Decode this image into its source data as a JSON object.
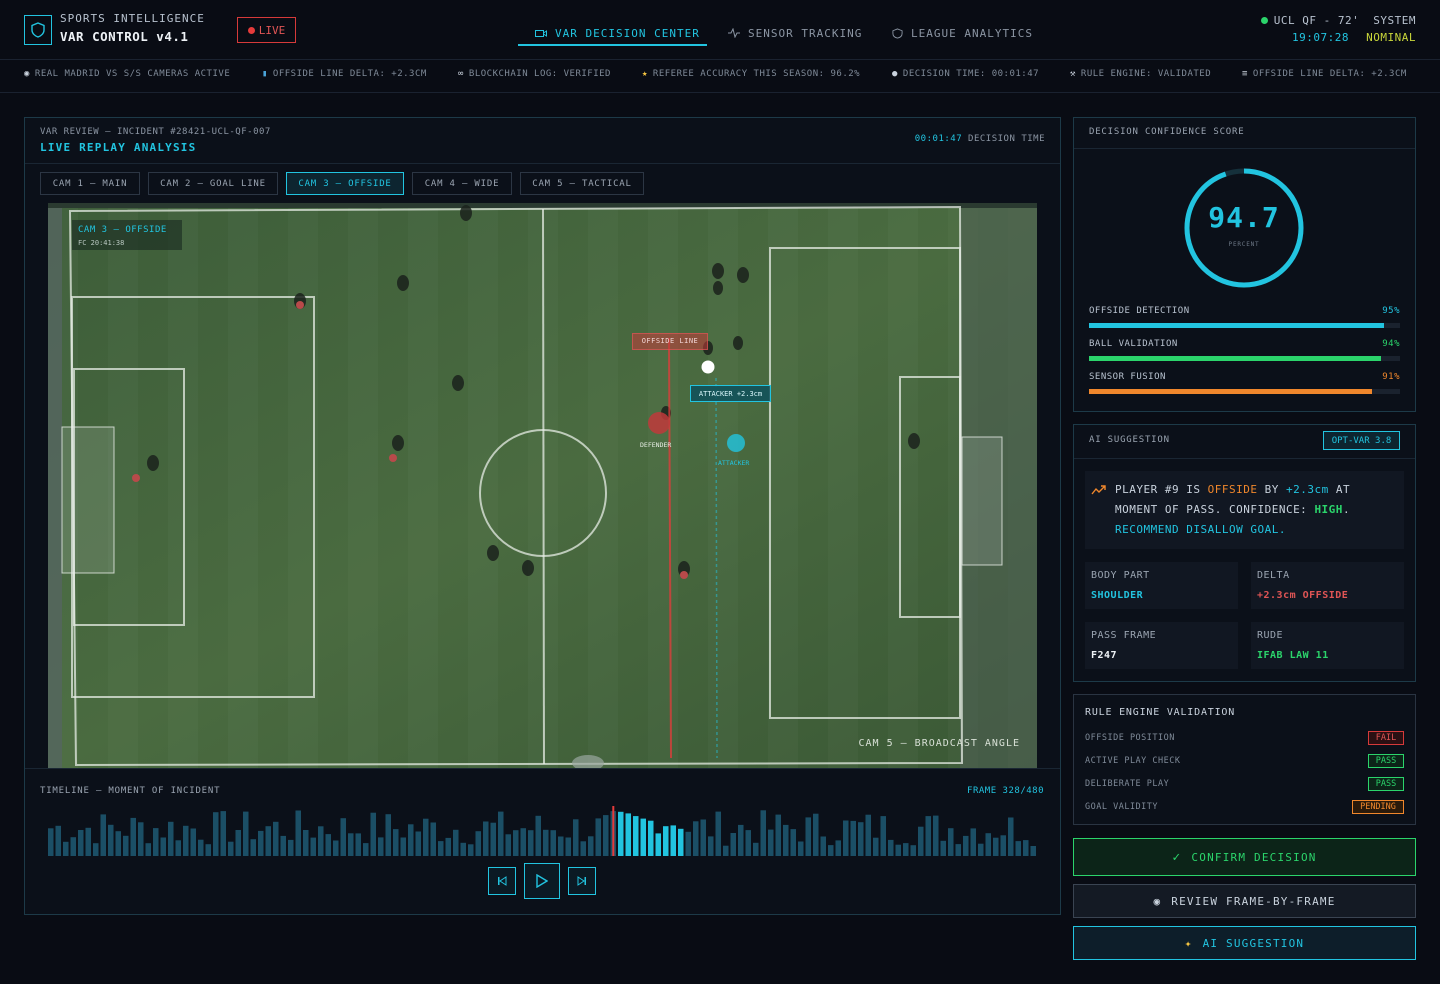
{
  "header": {
    "brand_line1": "SPORTS INTELLIGENCE",
    "brand_line2": "VAR CONTROL v4.1",
    "live_label": "LIVE",
    "nav": [
      {
        "label": "VAR DECISION CENTER",
        "icon": "camera-icon",
        "active": true
      },
      {
        "label": "SENSOR TRACKING",
        "icon": "pulse-icon",
        "active": false
      },
      {
        "label": "LEAGUE ANALYTICS",
        "icon": "shield-icon",
        "active": false
      }
    ],
    "match": "UCL QF - 72'",
    "system_label": "SYSTEM",
    "clock": "19:07:28",
    "system_status": "NOMINAL",
    "colors": {
      "accent": "#22c4e0",
      "ok": "#2bd46b",
      "alert": "#e53b3b",
      "warn": "#f0872c"
    }
  },
  "ticker": [
    {
      "icon": "camera-icon",
      "text": "REAL MADRID VS S/S CAMERAS ACTIVE"
    },
    {
      "icon": "chart-icon",
      "text": "OFFSIDE LINE DELTA: +2.3CM"
    },
    {
      "icon": "link-icon",
      "text": "BLOCKCHAIN LOG: VERIFIED"
    },
    {
      "icon": "star-icon",
      "text": "REFEREE ACCURACY THIS SEASON: 96.2%"
    },
    {
      "icon": "clock-icon",
      "text": "DECISION TIME: 00:01:47"
    },
    {
      "icon": "wrench-icon",
      "text": "RULE ENGINE: VALIDATED"
    },
    {
      "icon": "sensor-icon",
      "text": "OFFSIDE LINE DELTA: +2.3CM"
    }
  ],
  "review": {
    "incident": "VAR REVIEW — INCIDENT #28421-UCL-QF-007",
    "title": "LIVE REPLAY ANALYSIS",
    "decision_time_value": "00:01:47",
    "decision_time_label": "DECISION TIME",
    "cams": [
      {
        "label": "CAM 1 — MAIN",
        "active": false
      },
      {
        "label": "CAM 2 — GOAL LINE",
        "active": false
      },
      {
        "label": "CAM 3 — OFFSIDE",
        "active": true
      },
      {
        "label": "CAM 4 — WIDE",
        "active": false
      },
      {
        "label": "CAM 5 — TACTICAL",
        "active": false
      }
    ],
    "overlay_cam": "CAM 3 — OFFSIDE",
    "overlay_tc": "FC 20:41:38",
    "offside_line_label": "OFFSIDE LINE",
    "attacker_tag": "ATTACKER +2.3cm",
    "defender_label": "DEFENDER",
    "attacker_label": "ATTACKER",
    "broadcast_label": "CAM 5 — BROADCAST ANGLE",
    "timeline_label": "TIMELINE — MOMENT OF INCIDENT",
    "frame_label": "FRAME 328/480",
    "timeline_playhead_fraction": 0.57
  },
  "confidence": {
    "title": "DECISION CONFIDENCE SCORE",
    "score": "94.7",
    "unit": "PERCENT",
    "score_fraction": 0.947,
    "metrics": [
      {
        "label": "OFFSIDE DETECTION",
        "value": "95%",
        "fraction": 0.95,
        "color": "#22c4e0"
      },
      {
        "label": "BALL VALIDATION",
        "value": "94%",
        "fraction": 0.94,
        "color": "#2bd46b"
      },
      {
        "label": "SENSOR FUSION",
        "value": "91%",
        "fraction": 0.91,
        "color": "#f0872c"
      }
    ]
  },
  "ai": {
    "title": "AI SUGGESTION",
    "version": "OPT-VAR 3.8",
    "line1": {
      "a": "PLAYER #9 IS ",
      "b": "OFFSIDE",
      "c": " BY ",
      "d": "+2.3cm",
      "e": " AT"
    },
    "line2": {
      "a": "MOMENT OF PASS. CONFIDENCE: ",
      "b": "HIGH",
      "c": "."
    },
    "line3": "RECOMMEND DISALLOW GOAL.",
    "details": [
      {
        "key": "BODY PART",
        "value": "SHOULDER",
        "color": "#22c4e0"
      },
      {
        "key": "DELTA",
        "value": "+2.3cm OFFSIDE",
        "color": "#e05555"
      },
      {
        "key": "PASS FRAME",
        "value": "F247",
        "color": "#eef2f6"
      },
      {
        "key": "RUDE",
        "value": "IFAB LAW 11",
        "color": "#2bd46b"
      }
    ]
  },
  "rules": {
    "title": "RULE ENGINE VALIDATION",
    "rows": [
      {
        "label": "OFFSIDE POSITION",
        "status": "FAIL",
        "kind": "fail"
      },
      {
        "label": "ACTIVE PLAY CHECK",
        "status": "PASS",
        "kind": "pass"
      },
      {
        "label": "DELIBERATE PLAY",
        "status": "PASS",
        "kind": "pass"
      },
      {
        "label": "GOAL VALIDITY",
        "status": "PENDING",
        "kind": "pend"
      }
    ]
  },
  "actions": {
    "confirm": "CONFIRM DECISION",
    "review": "REVIEW FRAME-BY-FRAME",
    "ai": "AI SUGGESTION"
  }
}
